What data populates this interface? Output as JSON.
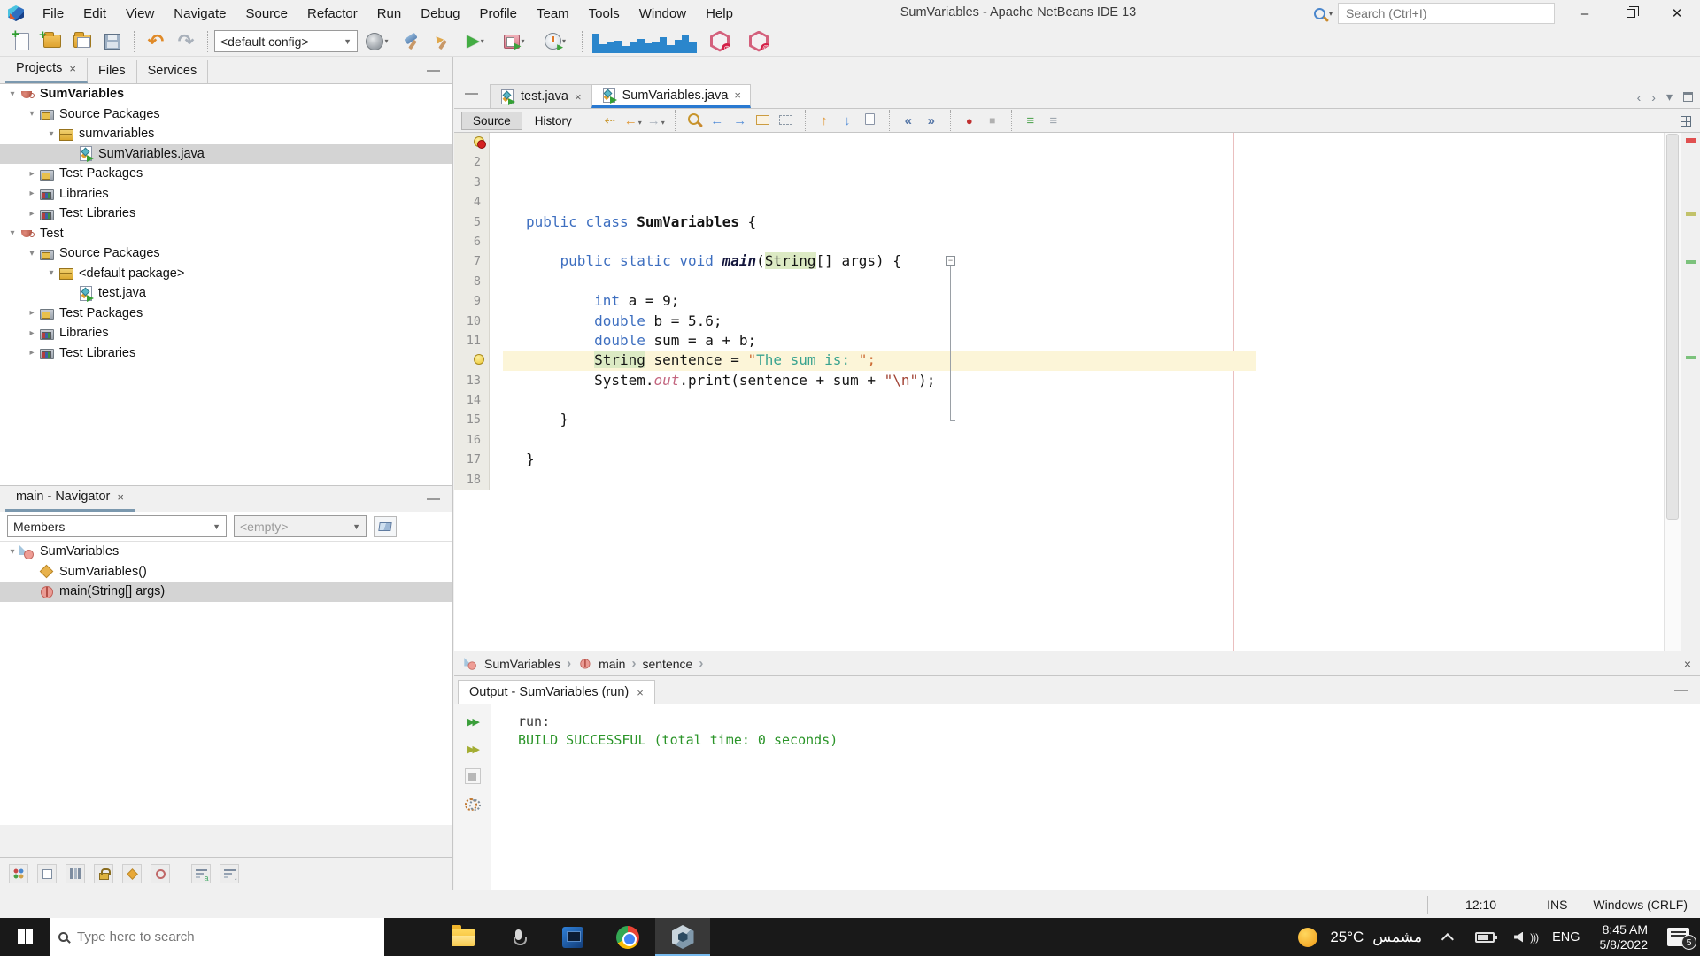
{
  "titlebar": {
    "title": "SumVariables - Apache NetBeans IDE 13",
    "search_placeholder": "Search (Ctrl+I)",
    "menus": [
      "File",
      "Edit",
      "View",
      "Navigate",
      "Source",
      "Refactor",
      "Run",
      "Debug",
      "Profile",
      "Team",
      "Tools",
      "Window",
      "Help"
    ]
  },
  "toolbar": {
    "config_value": "<default config>"
  },
  "left": {
    "tabs": {
      "projects": "Projects",
      "files": "Files",
      "services": "Services"
    },
    "tree": [
      {
        "label": "SumVariables",
        "icon": "project",
        "level": 0,
        "expand": "open",
        "bold": true
      },
      {
        "label": "Source Packages",
        "icon": "srcfolder",
        "level": 1,
        "expand": "open"
      },
      {
        "label": "sumvariables",
        "icon": "package",
        "level": 2,
        "expand": "open"
      },
      {
        "label": "SumVariables.java",
        "icon": "javafile",
        "level": 3,
        "expand": "none",
        "selected": true
      },
      {
        "label": "Test Packages",
        "icon": "srcfolder",
        "level": 1,
        "expand": "closed"
      },
      {
        "label": "Libraries",
        "icon": "libfolder",
        "level": 1,
        "expand": "closed"
      },
      {
        "label": "Test Libraries",
        "icon": "libfolder",
        "level": 1,
        "expand": "closed"
      },
      {
        "label": "Test",
        "icon": "project",
        "level": 0,
        "expand": "open"
      },
      {
        "label": "Source Packages",
        "icon": "srcfolder",
        "level": 1,
        "expand": "open"
      },
      {
        "label": "<default package>",
        "icon": "package",
        "level": 2,
        "expand": "open"
      },
      {
        "label": "test.java",
        "icon": "javafile",
        "level": 3,
        "expand": "none"
      },
      {
        "label": "Test Packages",
        "icon": "srcfolder",
        "level": 1,
        "expand": "closed"
      },
      {
        "label": "Libraries",
        "icon": "libfolder",
        "level": 1,
        "expand": "closed"
      },
      {
        "label": "Test Libraries",
        "icon": "libfolder",
        "level": 1,
        "expand": "closed"
      }
    ]
  },
  "navigator": {
    "tab": "main - Navigator",
    "filter_value": "Members",
    "secondary_value": "<empty>",
    "tree": [
      {
        "label": "SumVariables",
        "icon": "class",
        "level": 0,
        "expand": "open"
      },
      {
        "label": "SumVariables()",
        "icon": "ctor",
        "level": 1,
        "expand": "none"
      },
      {
        "label": "main(String[] args)",
        "icon": "method",
        "level": 1,
        "expand": "none",
        "selected": true
      }
    ]
  },
  "editor": {
    "tabs": [
      {
        "label": "test.java"
      },
      {
        "label": "SumVariables.java",
        "active": true
      }
    ],
    "toolbar": {
      "source_label": "Source",
      "history_label": "History"
    },
    "breadcrumbs": [
      "SumVariables",
      "main",
      "sentence"
    ],
    "code": [
      {
        "n": "1",
        "icon": "error-bulb",
        "tokens": []
      },
      {
        "n": "2",
        "tokens": []
      },
      {
        "n": "3",
        "tokens": []
      },
      {
        "n": "4",
        "tokens": []
      },
      {
        "n": "5",
        "tokens": [
          [
            "public",
            "kw"
          ],
          [
            " ",
            "pl"
          ],
          [
            "class",
            "kw"
          ],
          [
            " ",
            "pl"
          ],
          [
            "SumVariables",
            "typ"
          ],
          [
            " {",
            "pl"
          ]
        ]
      },
      {
        "n": "6",
        "tokens": []
      },
      {
        "n": "7",
        "fold": "start",
        "tokens": [
          [
            "    ",
            "pl"
          ],
          [
            "public",
            "kw"
          ],
          [
            " ",
            "pl"
          ],
          [
            "static",
            "kw"
          ],
          [
            " ",
            "pl"
          ],
          [
            "void",
            "kw"
          ],
          [
            " ",
            "pl"
          ],
          [
            "main",
            "mth"
          ],
          [
            "(",
            "pl"
          ],
          [
            "String",
            "hl"
          ],
          [
            "[] args) {",
            "pl"
          ]
        ]
      },
      {
        "n": "8",
        "tokens": []
      },
      {
        "n": "9",
        "tokens": [
          [
            "        ",
            "pl"
          ],
          [
            "int",
            "kw"
          ],
          [
            " a = 9;",
            "pl"
          ]
        ]
      },
      {
        "n": "10",
        "tokens": [
          [
            "        ",
            "pl"
          ],
          [
            "double",
            "kw"
          ],
          [
            " b = 5.6;",
            "pl"
          ]
        ]
      },
      {
        "n": "11",
        "tokens": [
          [
            "        ",
            "pl"
          ],
          [
            "double",
            "kw"
          ],
          [
            " sum = a + b;",
            "pl"
          ]
        ]
      },
      {
        "n": "12",
        "icon": "bulb",
        "current": true,
        "tokens": [
          [
            "        ",
            "pl"
          ],
          [
            "String",
            "hl"
          ],
          [
            " sentence = ",
            "pl"
          ],
          [
            "\"",
            "strq"
          ],
          [
            "The sum is: ",
            "str"
          ],
          [
            "\";",
            "strq"
          ]
        ]
      },
      {
        "n": "13",
        "tokens": [
          [
            "        ",
            "pl"
          ],
          [
            "System.",
            "pl"
          ],
          [
            "out",
            "fld"
          ],
          [
            ".print(sentence + sum + ",
            "pl"
          ],
          [
            "\"\\n\"",
            "esc"
          ],
          [
            ");",
            "pl"
          ]
        ]
      },
      {
        "n": "14",
        "tokens": []
      },
      {
        "n": "15",
        "fold": "end",
        "tokens": [
          [
            "    }",
            "pl"
          ]
        ]
      },
      {
        "n": "16",
        "tokens": []
      },
      {
        "n": "17",
        "tokens": [
          [
            "}",
            "pl"
          ]
        ]
      },
      {
        "n": "18",
        "tokens": []
      }
    ]
  },
  "output": {
    "tab": "Output - SumVariables (run)",
    "lines": [
      {
        "text": "run:",
        "color": "default"
      },
      {
        "text": "BUILD SUCCESSFUL (total time: 0 seconds)",
        "color": "green"
      }
    ]
  },
  "statusbar": {
    "time": "12:10",
    "insert_mode": "INS",
    "line_ending": "Windows (CRLF)"
  },
  "taskbar": {
    "search_placeholder": "Type here to search",
    "temperature": "25°C",
    "weather": "مشمس",
    "language": "ENG",
    "time": "8:45 AM",
    "date": "5/8/2022",
    "notification_count": "5"
  },
  "colors": {
    "accent_blue": "#2979d1",
    "run_green": "#3a9e3a",
    "output_green": "#2a9428",
    "memory_graph": "#2b86cc"
  }
}
